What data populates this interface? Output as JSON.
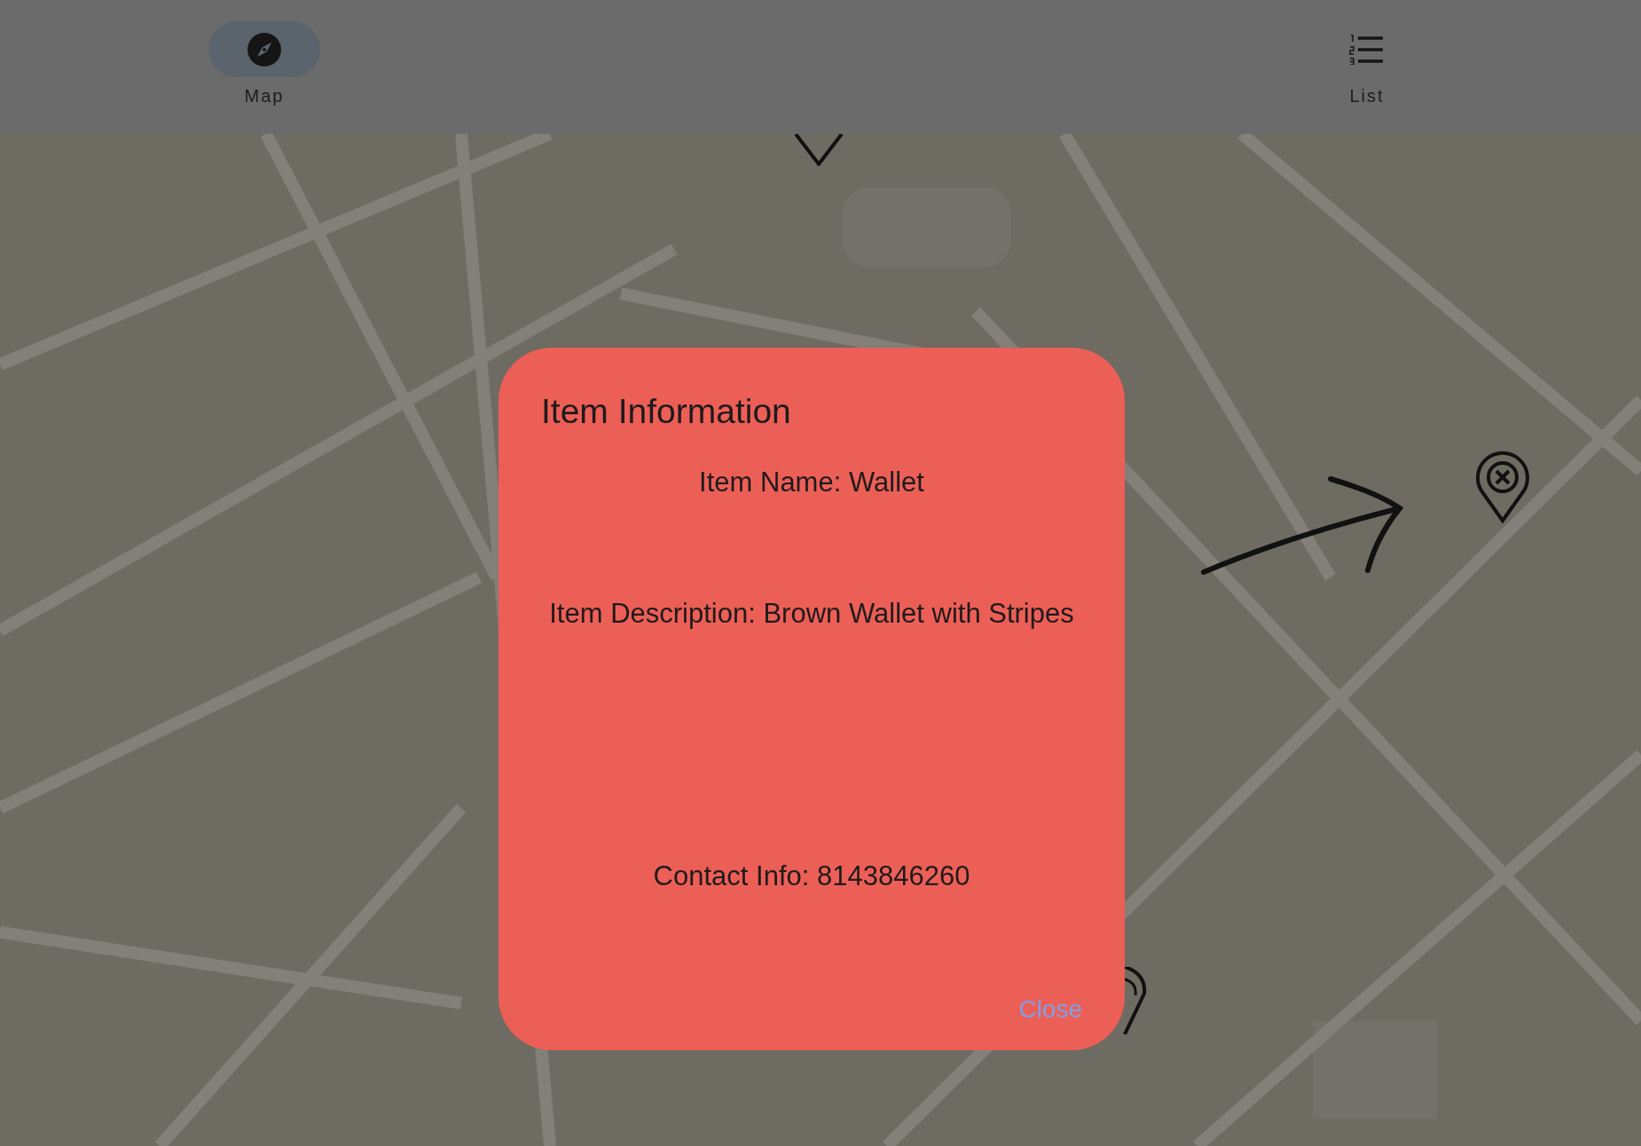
{
  "nav": [
    {
      "label": "Map",
      "kind": "compass",
      "selected": true
    },
    {
      "label": "List",
      "kind": "list",
      "selected": false
    }
  ],
  "dialog": {
    "title": "Item Information",
    "lines": [
      {
        "text": "Item Name: Wallet"
      },
      {
        "text": "Item Description: Brown Wallet with Stripes"
      },
      {
        "text": "Contact Info: 8143846260"
      }
    ],
    "close": "Close"
  }
}
